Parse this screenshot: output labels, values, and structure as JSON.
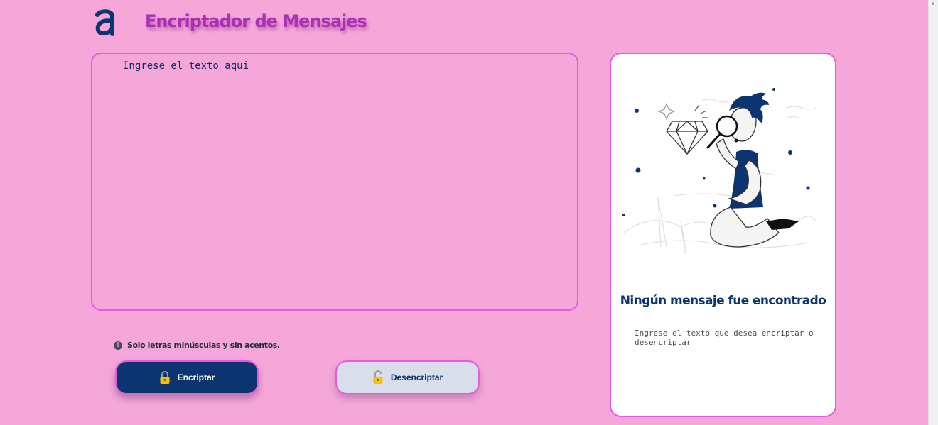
{
  "header": {
    "logo_icon": "stylized-a-logo-icon",
    "title": "Encriptador de Mensajes"
  },
  "editor": {
    "placeholder": "Ingrese el texto aqui",
    "value": ""
  },
  "hint": {
    "icon": "exclamation-circle-icon",
    "text": "Solo letras minúsculas y sin acentos."
  },
  "buttons": {
    "encrypt": {
      "label": "Encriptar",
      "icon": "locked-padlock-icon"
    },
    "decrypt": {
      "label": "Desencriptar",
      "icon": "unlocked-padlock-icon"
    }
  },
  "result_panel": {
    "illustration": "person-with-magnifying-glass-illustration",
    "title": "Ningún mensaje fue encontrado",
    "text": "Ingrese el texto que desea encriptar o desencriptar"
  },
  "colors": {
    "background": "#f5a7d9",
    "accent_border": "#e75ae0",
    "primary": "#0b3470",
    "title": "#a92fb4",
    "secondary_button": "#d8dfea"
  }
}
